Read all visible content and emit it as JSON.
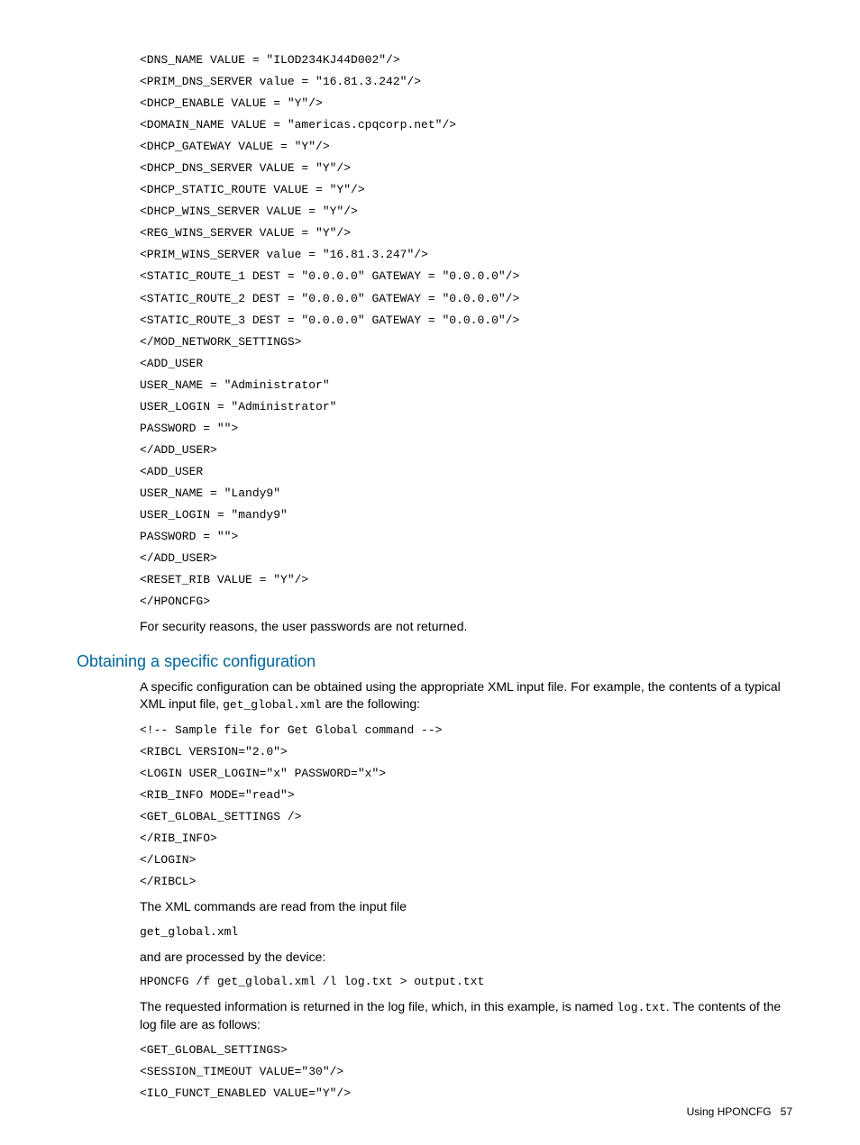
{
  "code1": "<DNS_NAME VALUE = \"ILOD234KJ44D002\"/>\n<PRIM_DNS_SERVER value = \"16.81.3.242\"/>\n<DHCP_ENABLE VALUE = \"Y\"/>\n<DOMAIN_NAME VALUE = \"americas.cpqcorp.net\"/>\n<DHCP_GATEWAY VALUE = \"Y\"/>\n<DHCP_DNS_SERVER VALUE = \"Y\"/>\n<DHCP_STATIC_ROUTE VALUE = \"Y\"/>\n<DHCP_WINS_SERVER VALUE = \"Y\"/>\n<REG_WINS_SERVER VALUE = \"Y\"/>\n<PRIM_WINS_SERVER value = \"16.81.3.247\"/>\n<STATIC_ROUTE_1 DEST = \"0.0.0.0\" GATEWAY = \"0.0.0.0\"/>\n<STATIC_ROUTE_2 DEST = \"0.0.0.0\" GATEWAY = \"0.0.0.0\"/>\n<STATIC_ROUTE_3 DEST = \"0.0.0.0\" GATEWAY = \"0.0.0.0\"/>\n</MOD_NETWORK_SETTINGS>\n<ADD_USER\nUSER_NAME = \"Administrator\"\nUSER_LOGIN = \"Administrator\"\nPASSWORD = \"\">\n</ADD_USER>\n<ADD_USER\nUSER_NAME = \"Landy9\"\nUSER_LOGIN = \"mandy9\"\nPASSWORD = \"\">\n</ADD_USER>\n<RESET_RIB VALUE = \"Y\"/>\n</HPONCFG>",
  "para1": "For security reasons, the user passwords are not returned.",
  "heading": "Obtaining a specific configuration",
  "para2a": "A specific configuration can be obtained using the appropriate XML input file. For example, the contents of a typical XML input file, ",
  "para2code": "get_global.xml",
  "para2b": " are the following:",
  "code2": "<!-- Sample file for Get Global command -->\n<RIBCL VERSION=\"2.0\">\n<LOGIN USER_LOGIN=\"x\" PASSWORD=\"x\">\n<RIB_INFO MODE=\"read\">\n<GET_GLOBAL_SETTINGS />\n</RIB_INFO>\n</LOGIN>\n</RIBCL>",
  "para3": "The XML commands are read from the input file",
  "code3": "get_global.xml",
  "para4": "and are processed by the device:",
  "code4": "HPONCFG /f get_global.xml /l log.txt > output.txt",
  "para5a": "The requested information is returned in the log file, which, in this example, is named ",
  "para5code": "log.txt",
  "para5b": ". The contents of the log file are as follows:",
  "code5": "<GET_GLOBAL_SETTINGS>\n<SESSION_TIMEOUT VALUE=\"30\"/>\n<ILO_FUNCT_ENABLED VALUE=\"Y\"/>",
  "footer_label": "Using HPONCFG",
  "footer_page": "57"
}
